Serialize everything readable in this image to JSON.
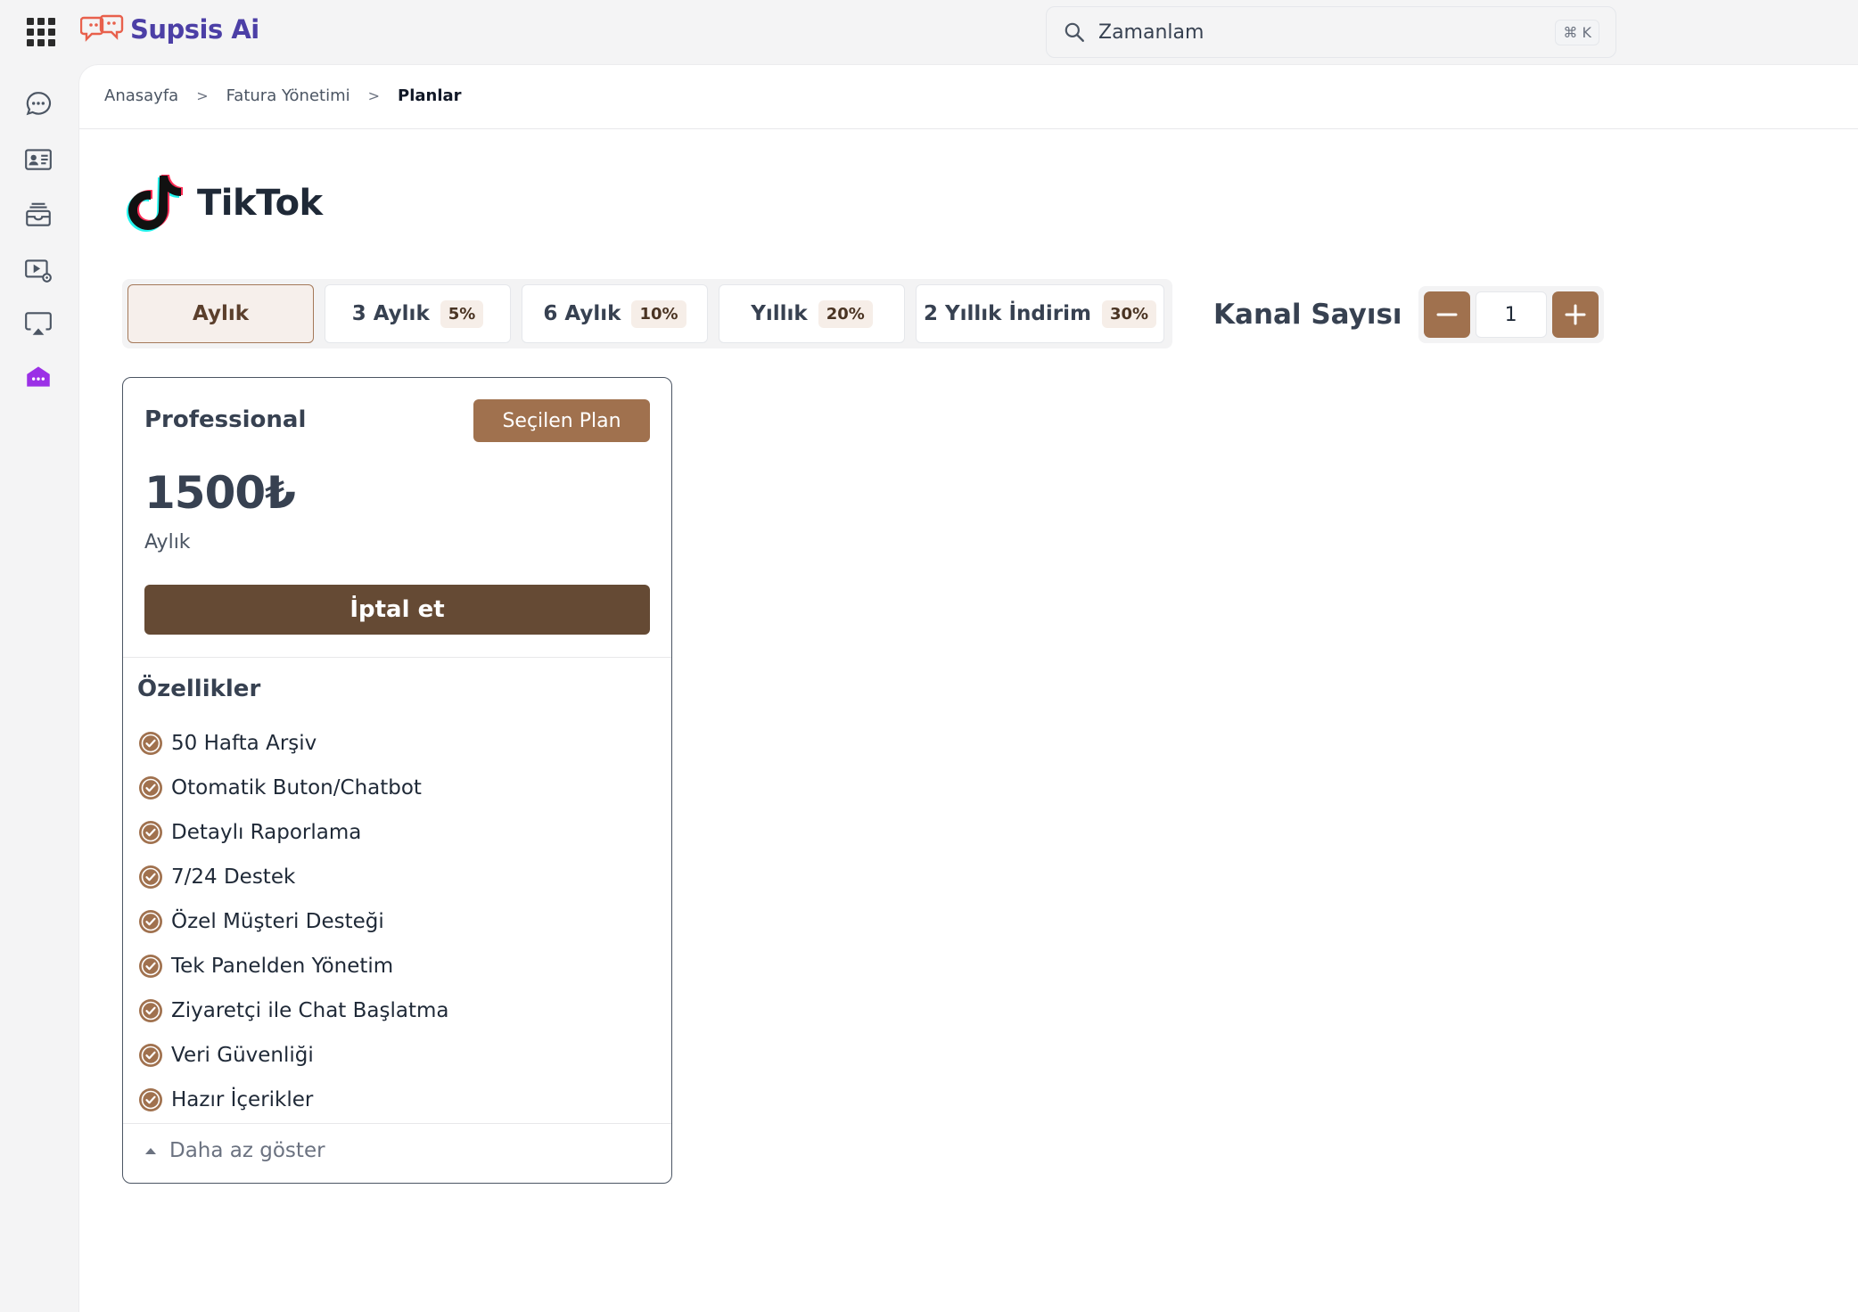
{
  "app": {
    "brand": "Supsis Ai",
    "accent_color": "#a0714e",
    "brand_color": "#4c3fa6"
  },
  "search": {
    "value": "Zamanlam",
    "shortcut": "⌘ K"
  },
  "sidebar": {
    "items": [
      {
        "icon": "chat-bubble-icon"
      },
      {
        "icon": "contact-card-icon"
      },
      {
        "icon": "inbox-archive-icon"
      },
      {
        "icon": "video-settings-icon"
      },
      {
        "icon": "airplay-screen-icon"
      },
      {
        "icon": "store-icon",
        "active": true
      }
    ]
  },
  "breadcrumb": {
    "items": [
      "Anasayfa",
      "Fatura Yönetimi",
      "Planlar"
    ]
  },
  "page": {
    "title": "TikTok",
    "icon": "tiktok-logo"
  },
  "tabs": [
    {
      "label": "Aylık",
      "badge": "",
      "active": true
    },
    {
      "label": "3 Aylık",
      "badge": "5%"
    },
    {
      "label": "6 Aylık",
      "badge": "10%"
    },
    {
      "label": "Yıllık",
      "badge": "20%"
    },
    {
      "label": "2 Yıllık İndirim",
      "badge": "30%"
    }
  ],
  "channel": {
    "label": "Kanal Sayısı",
    "value": "1"
  },
  "plan": {
    "name": "Professional",
    "selected_label": "Seçilen Plan",
    "price": "1500₺",
    "period": "Aylık",
    "cancel_label": "İptal et",
    "features_title": "Özellikler",
    "features": [
      "50 Hafta Arşiv",
      "Otomatik Buton/Chatbot",
      "Detaylı Raporlama",
      "7/24 Destek",
      "Özel Müşteri Desteği",
      "Tek Panelden Yönetim",
      "Ziyaretçi ile Chat Başlatma",
      "Veri Güvenliği",
      "Hazır İçerikler"
    ],
    "show_less_label": "Daha az göster"
  }
}
